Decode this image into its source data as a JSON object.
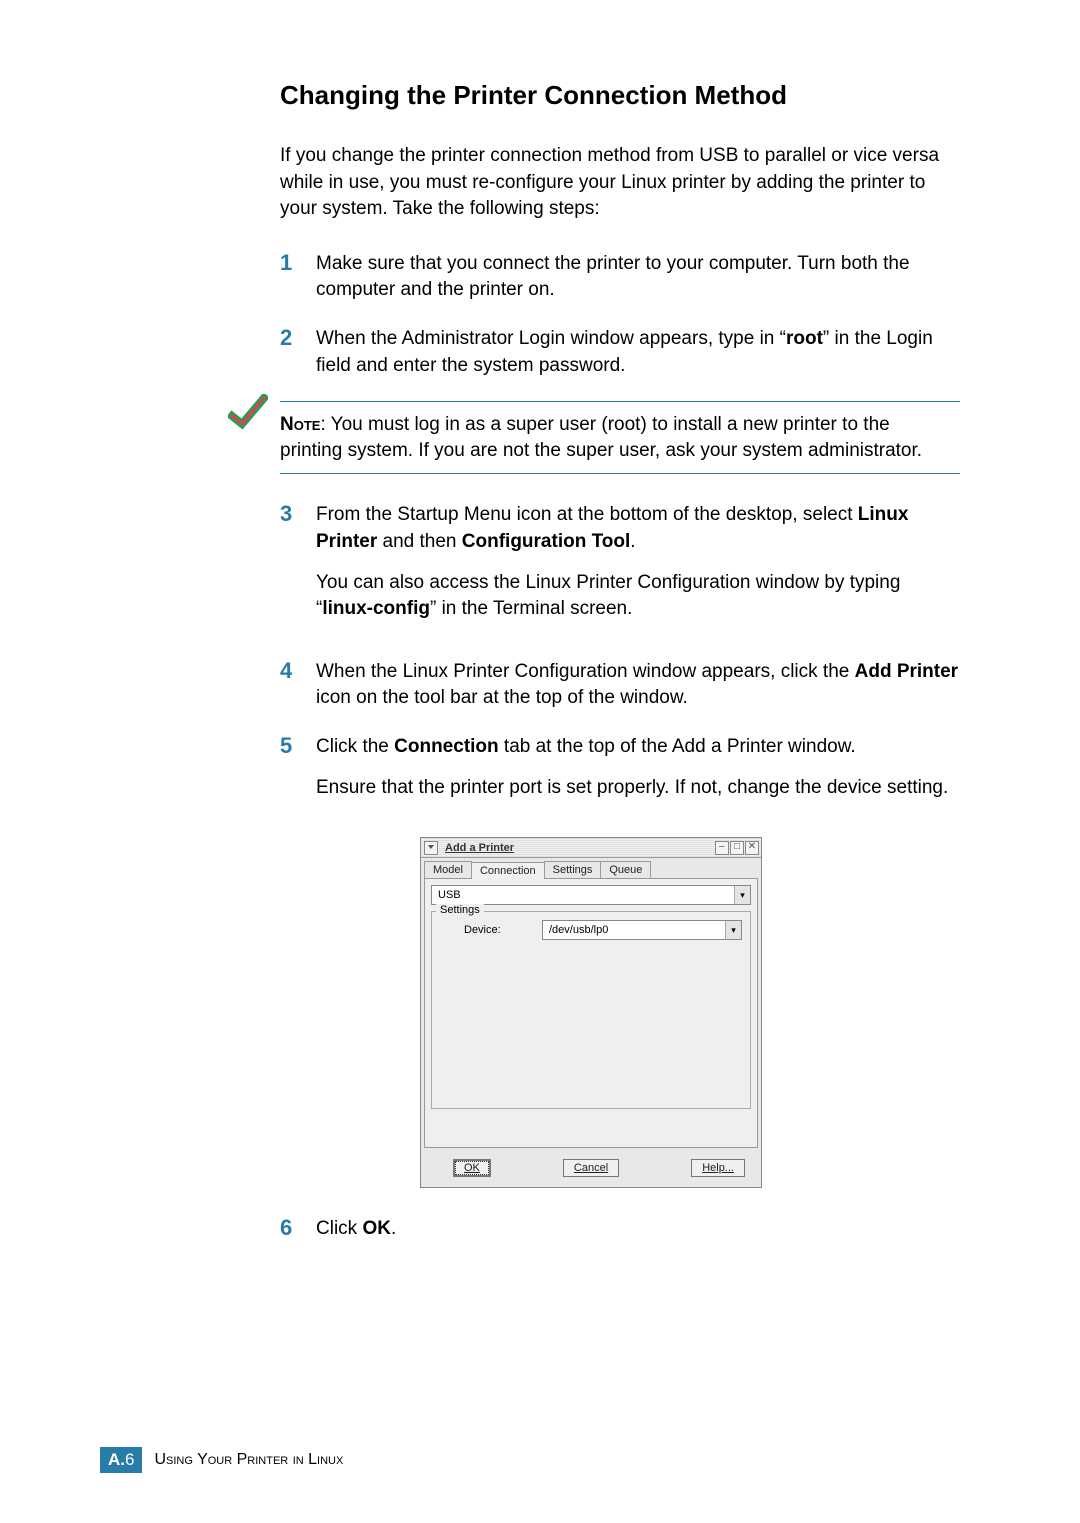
{
  "heading": "Changing the Printer Connection Method",
  "intro": "If you change the printer connection method from USB to parallel or vice versa while in use, you must re-configure your Linux printer by adding the printer to your system. Take the following steps:",
  "steps": [
    {
      "num": "1",
      "text": "Make sure that you connect the printer to your computer. Turn both the computer and the printer on."
    },
    {
      "num": "2",
      "text_pre": "When the Administrator Login window appears, type in “",
      "bold1": "root",
      "text_post": "” in the Login field and enter the system password."
    }
  ],
  "note": {
    "label": "Note",
    "text": ": You must log in as a super user (root) to install a new printer to the printing system. If you are not the super user, ask your system administrator."
  },
  "steps2": [
    {
      "num": "3",
      "line1_pre": "From the Startup Menu icon at the bottom of the desktop, select ",
      "line1_b1": "Linux Printer",
      "line1_mid": " and then ",
      "line1_b2": "Configuration Tool",
      "line1_post": ".",
      "line2_pre": "You can also access the Linux Printer Configuration window by typing “",
      "line2_b": "linux-config",
      "line2_post": "” in the Terminal screen."
    },
    {
      "num": "4",
      "text_pre": "When the Linux Printer Configuration window appears, click the ",
      "bold1": "Add Printer",
      "text_post": " icon on the tool bar at the top of the window."
    },
    {
      "num": "5",
      "line1_pre": "Click the ",
      "line1_b1": "Connection",
      "line1_post": " tab at the top of the Add a Printer window.",
      "line2": "Ensure that the printer port is set properly. If not, change the device setting."
    }
  ],
  "window": {
    "title": "Add a Printer",
    "tabs": [
      "Model",
      "Connection",
      "Settings",
      "Queue"
    ],
    "active_tab": 1,
    "port_combo": "USB",
    "settings_legend": "Settings",
    "device_label": "Device:",
    "device_value": "/dev/usb/lp0",
    "buttons": {
      "ok": "OK",
      "cancel": "Cancel",
      "help": "Help..."
    }
  },
  "step6": {
    "num": "6",
    "text_pre": "Click ",
    "bold1": "OK",
    "text_post": "."
  },
  "footer": {
    "badge_letter": "A.",
    "badge_num": "6",
    "text": "Using Your Printer in Linux"
  }
}
